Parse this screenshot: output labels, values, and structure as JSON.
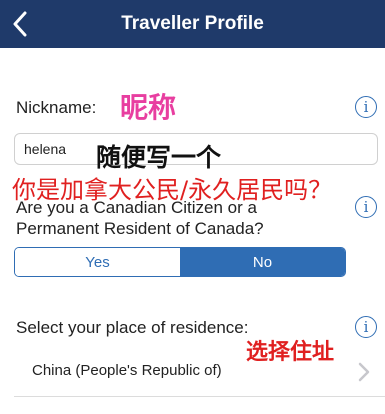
{
  "header": {
    "title": "Traveller Profile",
    "back_icon": "chevron-left-icon"
  },
  "nickname": {
    "label": "Nickname:",
    "value": "helena",
    "annotation": "昵称",
    "annotation_2": "随便写一个"
  },
  "citizen": {
    "annotation": "你是加拿大公民/永久居民吗？",
    "question_line1": "Are you a Canadian Citizen or a",
    "question_line2": "Permanent Resident of Canada?",
    "options": [
      {
        "label": "Yes",
        "selected": false
      },
      {
        "label": "No",
        "selected": true
      }
    ]
  },
  "residence": {
    "label": "Select your place of residence:",
    "annotation": "选择住址",
    "value": "China (People's Republic of)"
  },
  "info_icon_text": "i",
  "colors": {
    "header_bg": "#1f3a6a",
    "accent": "#2f6db4",
    "annotation_red": "#e02020",
    "annotation_pink": "#e83ea0"
  }
}
